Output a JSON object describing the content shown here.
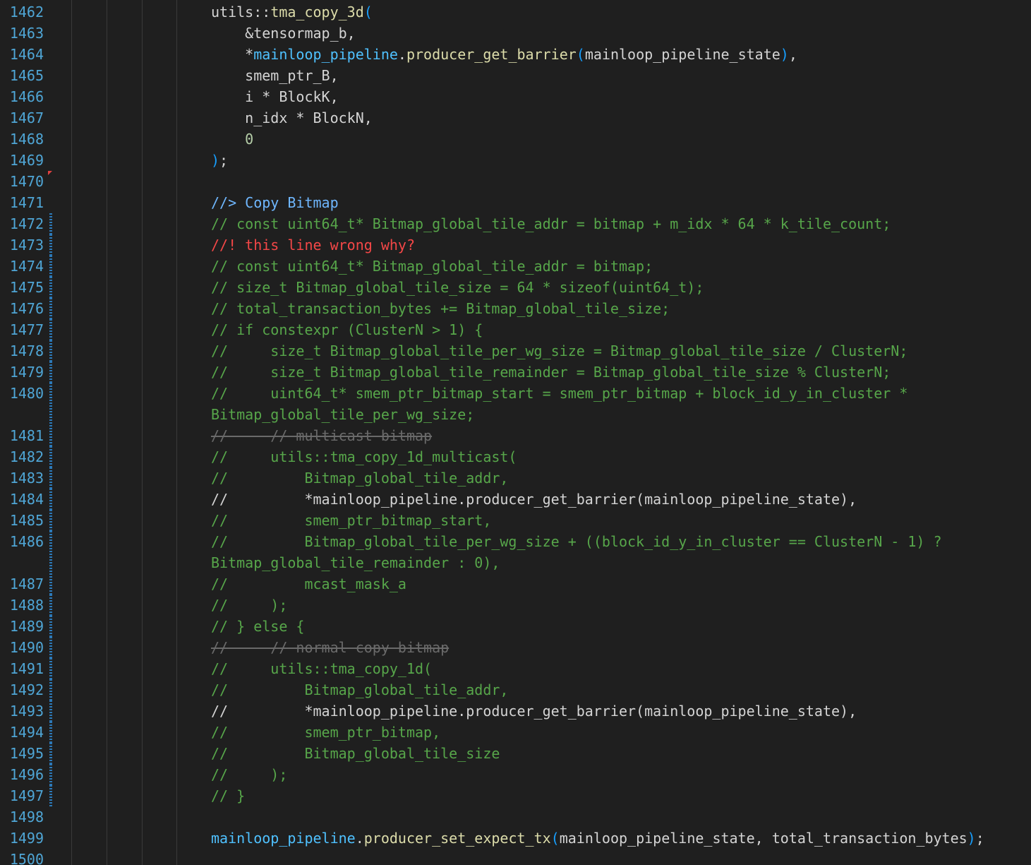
{
  "editor": {
    "first_line": 1462,
    "colors": {
      "background": "#1f1f1f",
      "line_number": "#4fa6d6",
      "comment": "#57a64a",
      "comment_highlight": "#6fb7ff",
      "comment_alert": "#f44747",
      "function": "#dcdcaa",
      "identifier": "#d4d4d4",
      "member_variable": "#4fc1ff"
    },
    "lines": [
      {
        "num": "1462",
        "text": "utils::tma_copy_3d(",
        "kind": "code"
      },
      {
        "num": "1463",
        "text": "    &tensormap_b,",
        "kind": "code"
      },
      {
        "num": "1464",
        "text": "    *mainloop_pipeline.producer_get_barrier(mainloop_pipeline_state),",
        "kind": "code"
      },
      {
        "num": "1465",
        "text": "    smem_ptr_B,",
        "kind": "code"
      },
      {
        "num": "1466",
        "text": "    i * BlockK,",
        "kind": "code"
      },
      {
        "num": "1467",
        "text": "    n_idx * BlockN,",
        "kind": "code"
      },
      {
        "num": "1468",
        "text": "    0",
        "kind": "code"
      },
      {
        "num": "1469",
        "text": ");",
        "kind": "code"
      },
      {
        "num": "1470",
        "text": "",
        "kind": "blank"
      },
      {
        "num": "1471",
        "text": "//> Copy Bitmap",
        "kind": "comment-blue"
      },
      {
        "num": "1472",
        "text": "// const uint64_t* Bitmap_global_tile_addr = bitmap + m_idx * 64 * k_tile_count;",
        "kind": "comment"
      },
      {
        "num": "1473",
        "text": "//! this line wrong why?",
        "kind": "comment-red"
      },
      {
        "num": "1474",
        "text": "// const uint64_t* Bitmap_global_tile_addr = bitmap;",
        "kind": "comment"
      },
      {
        "num": "1475",
        "text": "// size_t Bitmap_global_tile_size = 64 * sizeof(uint64_t);",
        "kind": "comment"
      },
      {
        "num": "1476",
        "text": "// total_transaction_bytes += Bitmap_global_tile_size;",
        "kind": "comment"
      },
      {
        "num": "1477",
        "text": "// if constexpr (ClusterN > 1) {",
        "kind": "comment"
      },
      {
        "num": "1478",
        "text": "//     size_t Bitmap_global_tile_per_wg_size = Bitmap_global_tile_size / ClusterN;",
        "kind": "comment"
      },
      {
        "num": "1479",
        "text": "//     size_t Bitmap_global_tile_remainder = Bitmap_global_tile_size % ClusterN;",
        "kind": "comment"
      },
      {
        "num": "1480",
        "text": "//     uint64_t* smem_ptr_bitmap_start = smem_ptr_bitmap + block_id_y_in_cluster *",
        "kind": "comment",
        "wrap": "Bitmap_global_tile_per_wg_size;"
      },
      {
        "num": "1481",
        "text": "//     // multicast bitmap",
        "kind": "strike"
      },
      {
        "num": "1482",
        "text": "//     utils::tma_copy_1d_multicast(",
        "kind": "comment"
      },
      {
        "num": "1483",
        "text": "//         Bitmap_global_tile_addr,",
        "kind": "comment"
      },
      {
        "num": "1484",
        "text": "//         *mainloop_pipeline.producer_get_barrier(mainloop_pipeline_state),",
        "kind": "comment-bright"
      },
      {
        "num": "1485",
        "text": "//         smem_ptr_bitmap_start,",
        "kind": "comment"
      },
      {
        "num": "1486",
        "text": "//         Bitmap_global_tile_per_wg_size + ((block_id_y_in_cluster == ClusterN - 1) ?",
        "kind": "comment",
        "wrap": "Bitmap_global_tile_remainder : 0),"
      },
      {
        "num": "1487",
        "text": "//         mcast_mask_a",
        "kind": "comment"
      },
      {
        "num": "1488",
        "text": "//     );",
        "kind": "comment"
      },
      {
        "num": "1489",
        "text": "// } else {",
        "kind": "comment"
      },
      {
        "num": "1490",
        "text": "//     // normal copy bitmap",
        "kind": "strike"
      },
      {
        "num": "1491",
        "text": "//     utils::tma_copy_1d(",
        "kind": "comment"
      },
      {
        "num": "1492",
        "text": "//         Bitmap_global_tile_addr,",
        "kind": "comment"
      },
      {
        "num": "1493",
        "text": "//         *mainloop_pipeline.producer_get_barrier(mainloop_pipeline_state),",
        "kind": "comment-bright"
      },
      {
        "num": "1494",
        "text": "//         smem_ptr_bitmap,",
        "kind": "comment"
      },
      {
        "num": "1495",
        "text": "//         Bitmap_global_tile_size",
        "kind": "comment"
      },
      {
        "num": "1496",
        "text": "//     );",
        "kind": "comment"
      },
      {
        "num": "1497",
        "text": "// }",
        "kind": "comment"
      },
      {
        "num": "1498",
        "text": "",
        "kind": "blank"
      },
      {
        "num": "1499",
        "text": "mainloop_pipeline.producer_set_expect_tx(mainloop_pipeline_state, total_transaction_bytes);",
        "kind": "code"
      },
      {
        "num": "1500",
        "text": "",
        "kind": "blank"
      }
    ]
  }
}
